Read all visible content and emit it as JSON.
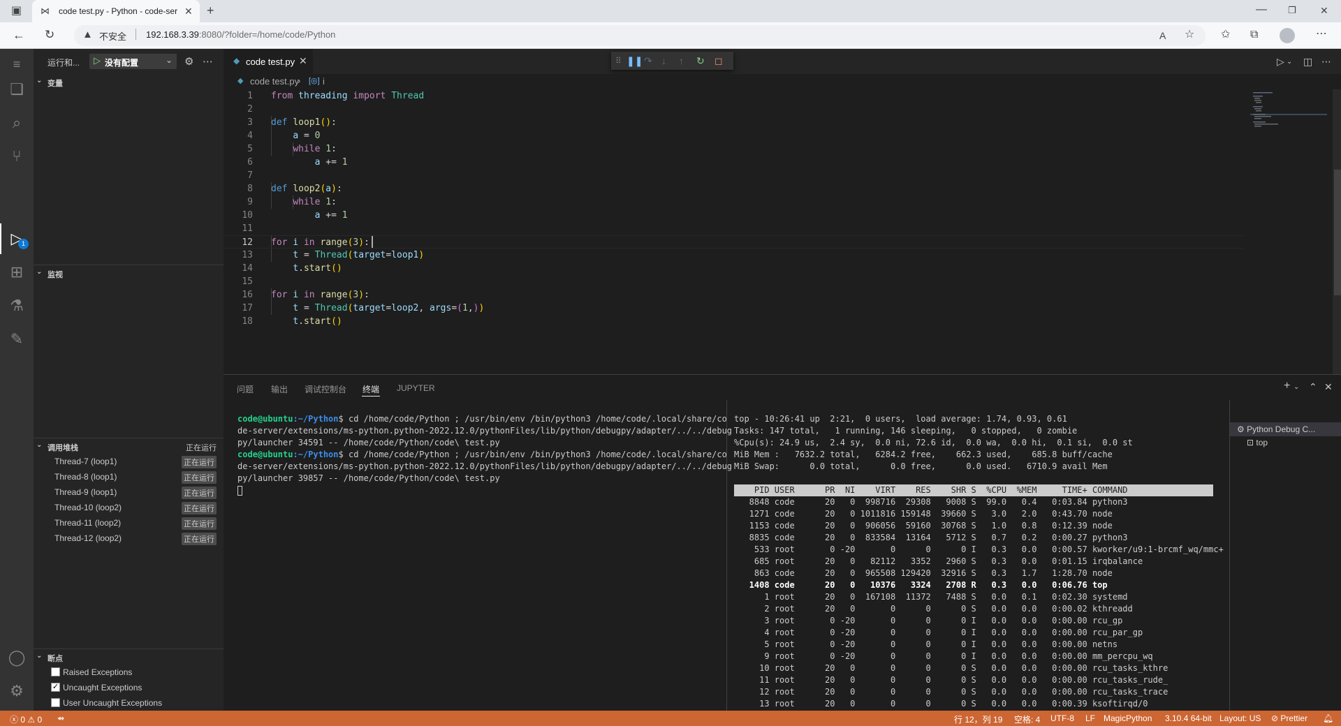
{
  "browser": {
    "tab_title": "code test.py - Python - code-server",
    "insecure_label": "不安全",
    "url_host": "192.168.3.39",
    "url_rest": ":8080/?folder=/home/code/Python",
    "icons": [
      "sidebar-toggle-icon",
      "code-server-tab-icon",
      "new-tab-icon",
      "minimize-icon",
      "restore-icon",
      "close-window-icon",
      "back-icon",
      "refresh-icon",
      "warning-icon",
      "read-aloud-icon",
      "favorite-add-icon",
      "favorites-icon",
      "collections-icon",
      "profile-avatar",
      "more-icon"
    ]
  },
  "activity_bar": {
    "debug_badge": "1",
    "icons": [
      "menu-icon",
      "explorer-icon",
      "search-icon",
      "source-control-icon",
      "run-debug-icon",
      "extensions-icon",
      "testing-icon",
      "remote-brush-icon",
      "account-icon",
      "settings-gear-icon"
    ]
  },
  "sidebar": {
    "run_label": "运行和...",
    "config_name": "没有配置",
    "variables_title": "变量",
    "watch_title": "监视",
    "callstack_title": "调用堆栈",
    "callstack_status": "正在运行",
    "threads": [
      {
        "name": "Thread-7 (loop1)",
        "status": "正在运行"
      },
      {
        "name": "Thread-8 (loop1)",
        "status": "正在运行"
      },
      {
        "name": "Thread-9 (loop1)",
        "status": "正在运行"
      },
      {
        "name": "Thread-10 (loop2)",
        "status": "正在运行"
      },
      {
        "name": "Thread-11 (loop2)",
        "status": "正在运行"
      },
      {
        "name": "Thread-12 (loop2)",
        "status": "正在运行"
      }
    ],
    "breakpoints_title": "断点",
    "breakpoints": [
      {
        "label": "Raised Exceptions",
        "checked": false
      },
      {
        "label": "Uncaught Exceptions",
        "checked": true
      },
      {
        "label": "User Uncaught Exceptions",
        "checked": false
      }
    ]
  },
  "editor": {
    "tab_name": "code test.py",
    "breadcrumb_file": "code test.py",
    "breadcrumb_symbol": "i",
    "current_line": 12,
    "line_numbers": [
      "1",
      "2",
      "3",
      "4",
      "5",
      "6",
      "7",
      "8",
      "9",
      "10",
      "11",
      "12",
      "13",
      "14",
      "15",
      "16",
      "17",
      "18"
    ],
    "code_lines": [
      "from threading import Thread",
      "",
      "def loop1():",
      "    a = 0",
      "    while 1:",
      "        a += 1",
      "",
      "def loop2(a):",
      "    while 1:",
      "        a += 1",
      "",
      "for i in range(3):",
      "    t = Thread(target=loop1)",
      "    t.start()",
      "",
      "for i in range(3):",
      "    t = Thread(target=loop2, args=(1,))",
      "    t.start()"
    ]
  },
  "panel": {
    "tabs": [
      "问题",
      "输出",
      "调试控制台",
      "终端",
      "JUPYTER"
    ],
    "active_tab": "终端",
    "terminal_left": {
      "prompt_user": "code@ubuntu",
      "prompt_path": ":~/Python",
      "cmd1": "$ cd /home/code/Python ; /usr/bin/env /bin/python3 /home/code/.local/share/co",
      "cmd1_l2": "de-server/extensions/ms-python.python-2022.12.0/pythonFiles/lib/python/debugpy/adapter/../../debug",
      "cmd1_l3": "py/launcher 34591 -- /home/code/Python/code\\ test.py",
      "cmd2": "$ cd /home/code/Python ; /usr/bin/env /bin/python3 /home/code/.local/share/co",
      "cmd2_l2": "de-server/extensions/ms-python.python-2022.12.0/pythonFiles/lib/python/debugpy/adapter/../../debug",
      "cmd2_l3": "py/launcher 39857 -- /home/code/Python/code\\ test.py"
    },
    "terminal_right": {
      "summary": [
        "top - 10:26:41 up  2:21,  0 users,  load average: 1.74, 0.93, 0.61",
        "Tasks: 147 total,   1 running, 146 sleeping,   0 stopped,   0 zombie",
        "%Cpu(s): 24.9 us,  2.4 sy,  0.0 ni, 72.6 id,  0.0 wa,  0.0 hi,  0.1 si,  0.0 st",
        "MiB Mem :   7632.2 total,   6284.2 free,    662.3 used,    685.8 buff/cache",
        "MiB Swap:      0.0 total,      0.0 free,      0.0 used.   6710.9 avail Mem"
      ],
      "header": "    PID USER      PR  NI    VIRT    RES    SHR S  %CPU  %MEM     TIME+ COMMAND",
      "rows": [
        "   8848 code      20   0  998716  29308   9008 S  99.0   0.4   0:03.84 python3",
        "   1271 code      20   0 1011816 159148  39660 S   3.0   2.0   0:43.70 node",
        "   1153 code      20   0  906056  59160  30768 S   1.0   0.8   0:12.39 node",
        "   8835 code      20   0  833584  13164   5712 S   0.7   0.2   0:00.27 python3",
        "    533 root       0 -20       0      0      0 I   0.3   0.0   0:00.57 kworker/u9:1-brcmf_wq/mmc+",
        "    685 root      20   0   82112   3352   2960 S   0.3   0.0   0:01.15 irqbalance",
        "    863 code      20   0  965508 129420  32916 S   0.3   1.7   1:28.70 node",
        "   1408 code      20   0   10376   3324   2708 R   0.3   0.0   0:06.76 top",
        "      1 root      20   0  167108  11372   7488 S   0.0   0.1   0:02.30 systemd",
        "      2 root      20   0       0      0      0 S   0.0   0.0   0:00.02 kthreadd",
        "      3 root       0 -20       0      0      0 I   0.0   0.0   0:00.00 rcu_gp",
        "      4 root       0 -20       0      0      0 I   0.0   0.0   0:00.00 rcu_par_gp",
        "      5 root       0 -20       0      0      0 I   0.0   0.0   0:00.00 netns",
        "      9 root       0 -20       0      0      0 I   0.0   0.0   0:00.00 mm_percpu_wq",
        "     10 root      20   0       0      0      0 S   0.0   0.0   0:00.00 rcu_tasks_kthre",
        "     11 root      20   0       0      0      0 S   0.0   0.0   0:00.00 rcu_tasks_rude_",
        "     12 root      20   0       0      0      0 S   0.0   0.0   0:00.00 rcu_tasks_trace",
        "     13 root      20   0       0      0      0 S   0.0   0.0   0:00.39 ksoftirqd/0"
      ],
      "bold_row_index": 7
    },
    "terminal_list": [
      "Python Debug C...",
      "top"
    ]
  },
  "statusbar": {
    "errors": "0",
    "warnings": "0",
    "position": "行 12，列 19",
    "spaces": "空格: 4",
    "encoding": "UTF-8",
    "eol": "LF",
    "language": "MagicPython",
    "interpreter": "3.10.4 64-bit",
    "layout": "Layout: US",
    "prettier": "Prettier"
  },
  "colors": {
    "statusbar": "#cc6633",
    "activitybar": "#333333",
    "sidebar": "#252526",
    "editor": "#1e1e1e",
    "accent": "#0e7ad4"
  }
}
